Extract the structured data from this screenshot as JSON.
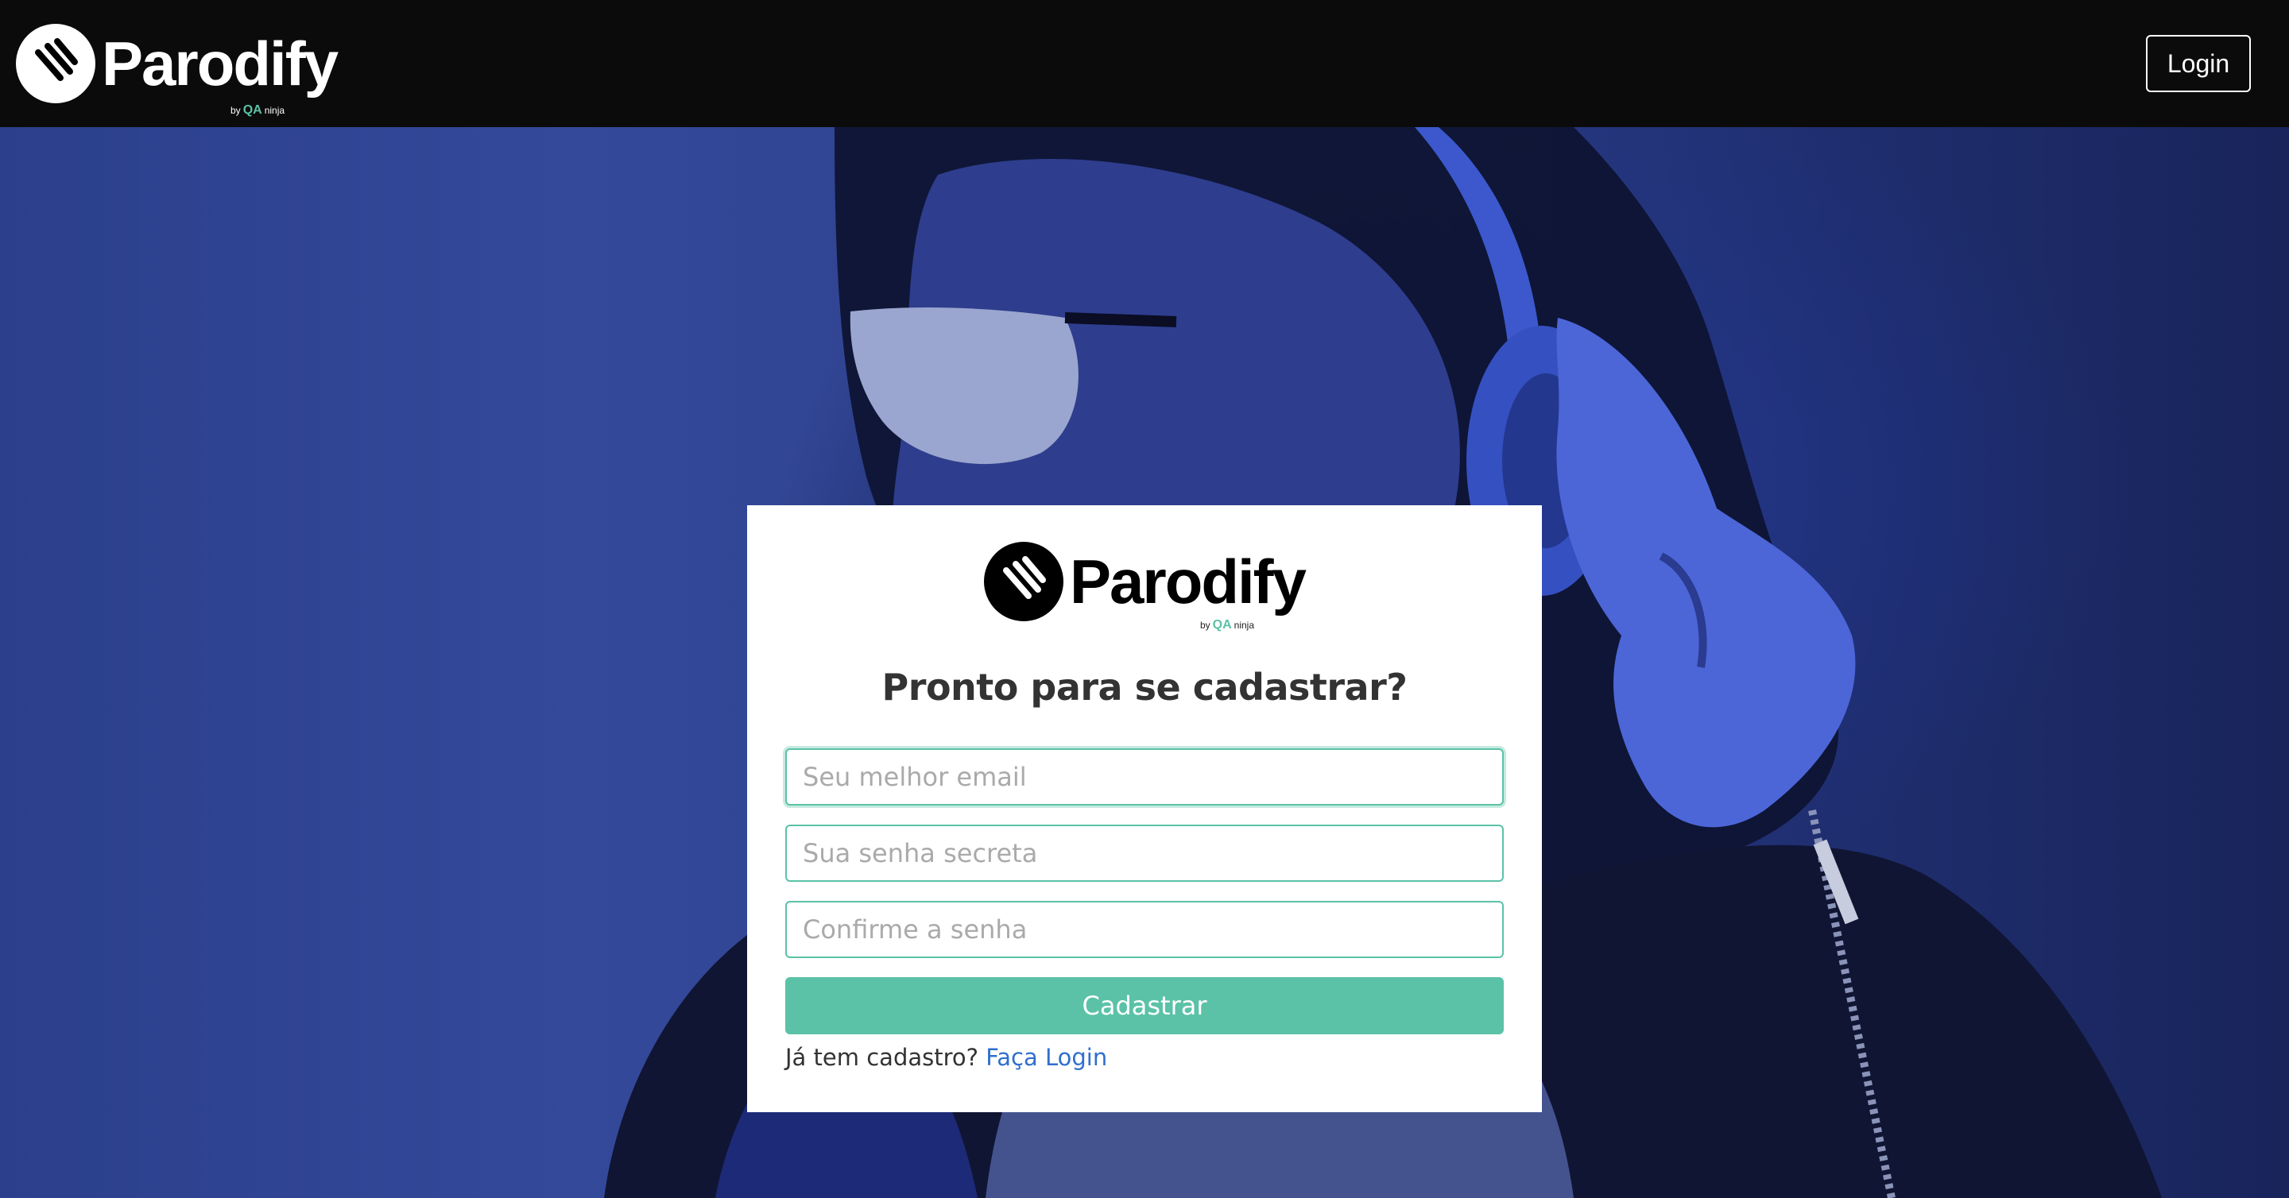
{
  "header": {
    "brand": {
      "name": "Parodify",
      "by": "by",
      "qa": "QA",
      "ninja": "ninja"
    },
    "login_label": "Login"
  },
  "card": {
    "brand": {
      "name": "Parodify",
      "by": "by",
      "qa": "QA",
      "ninja": "ninja"
    },
    "title": "Pronto para se cadastrar?",
    "fields": [
      {
        "placeholder": "Seu melhor email",
        "value": ""
      },
      {
        "placeholder": "Sua senha secreta",
        "value": ""
      },
      {
        "placeholder": "Confirme a senha",
        "value": ""
      }
    ],
    "submit_label": "Cadastrar",
    "footer_prompt": "Já tem cadastro?",
    "footer_link": "Faça Login"
  },
  "colors": {
    "topbar": "#0b0b0b",
    "accent": "#5bc2a7",
    "link": "#2f6fce",
    "hero": "#2b3f8c"
  },
  "icons": {
    "logo": "parodify-logo-icon",
    "background": "woman-with-headphones-photo"
  }
}
